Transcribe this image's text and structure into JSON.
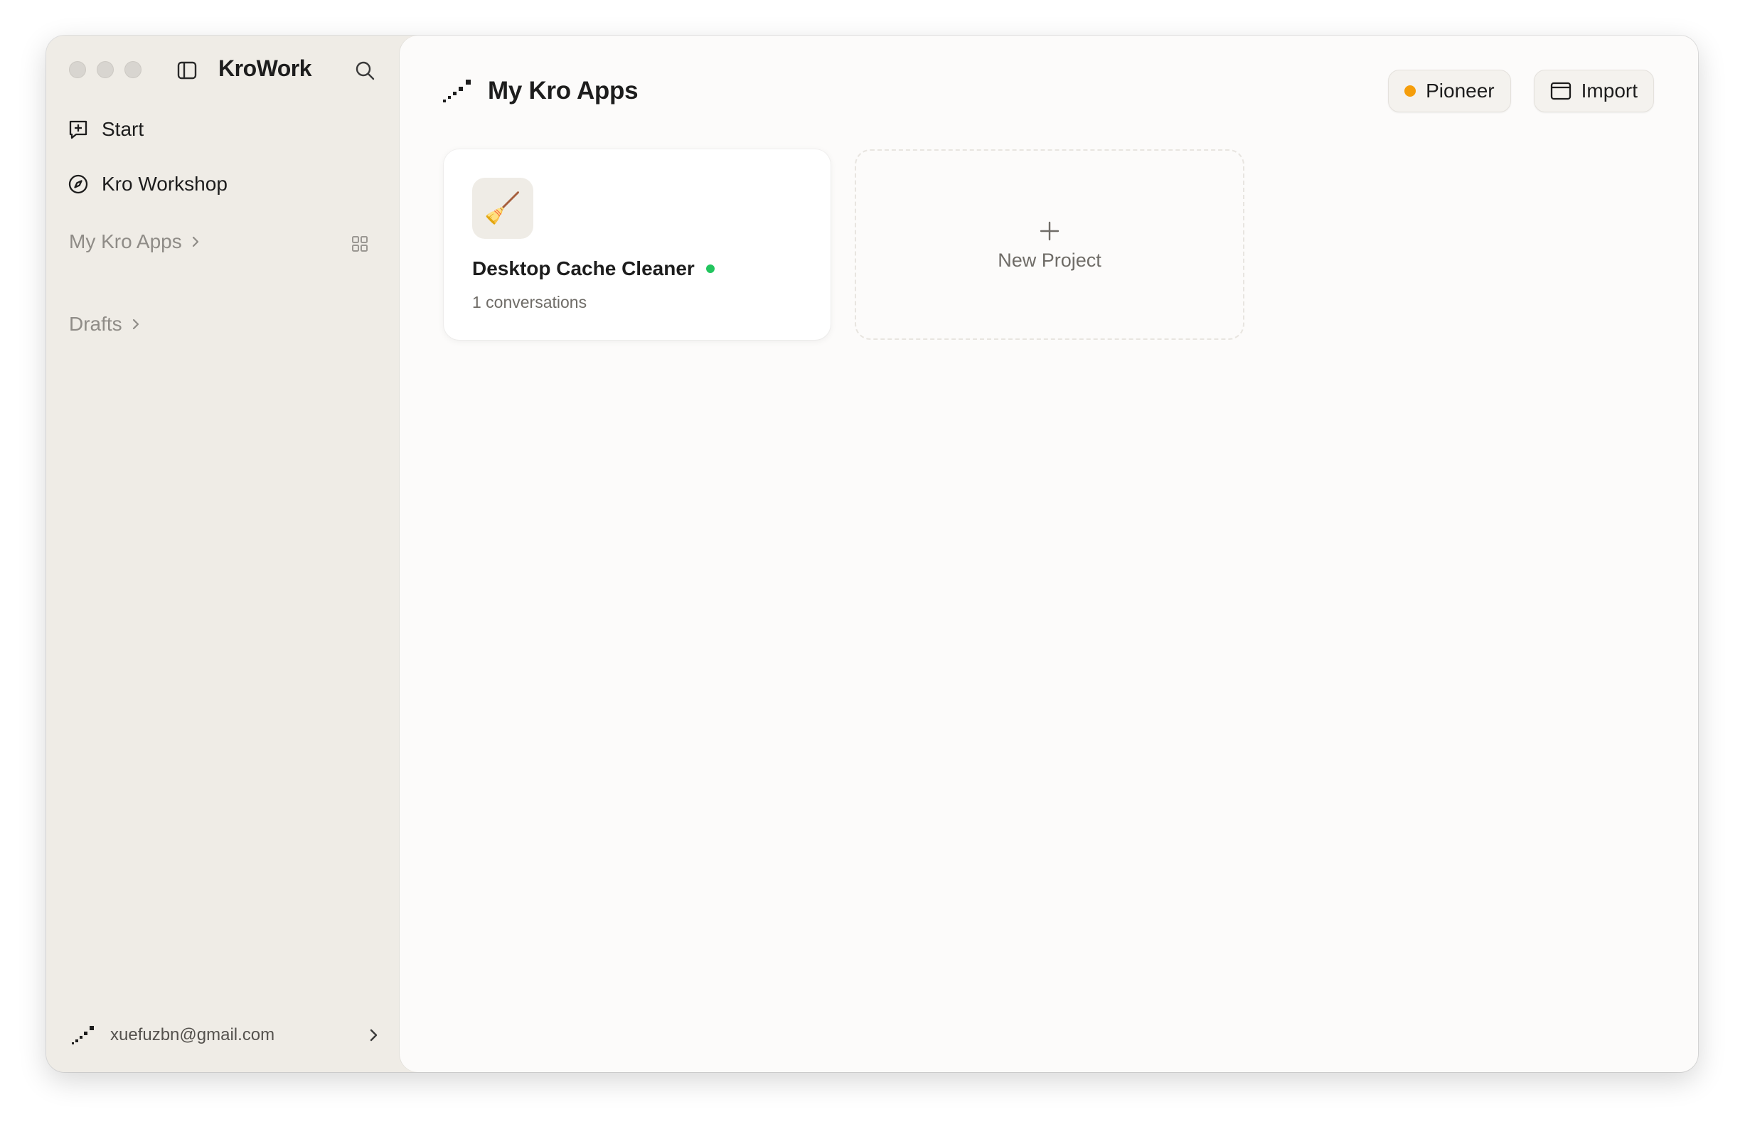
{
  "app": {
    "title": "KroWork"
  },
  "sidebar": {
    "nav": [
      {
        "label": "Start",
        "icon": "new-chat-icon"
      },
      {
        "label": "Kro Workshop",
        "icon": "compass-icon"
      }
    ],
    "sections": {
      "apps_label": "My Kro Apps",
      "drafts_label": "Drafts"
    },
    "account": {
      "email": "xuefuzbn@gmail.com"
    }
  },
  "main": {
    "title": "My Kro Apps",
    "actions": {
      "pioneer_label": "Pioneer",
      "import_label": "Import"
    },
    "projects": [
      {
        "icon": "🧹",
        "name": "Desktop Cache Cleaner",
        "meta": "1 conversations",
        "status": "active"
      }
    ],
    "new_project_label": "New Project"
  },
  "colors": {
    "accent_orange": "#f59e0b",
    "status_green": "#22c55e",
    "sidebar_bg": "#efece6",
    "main_bg": "#fcfbfa"
  }
}
